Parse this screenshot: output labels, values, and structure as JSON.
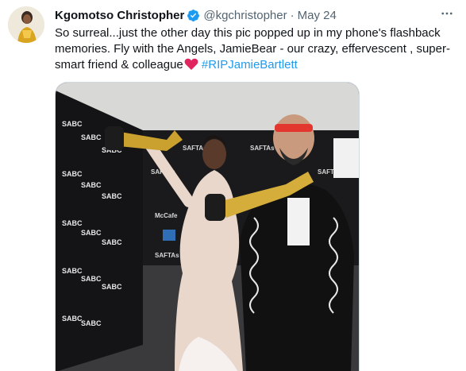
{
  "tweet": {
    "author_name": "Kgomotso Christopher",
    "handle": "@kgchristopher",
    "separator": "·",
    "date": "May 24",
    "text_lines": [
      "So surreal...just the other day this pic popped up in my phone's flashback",
      "memories. Fly with the Angels, JamieBear - our crazy, effervescent , super-"
    ],
    "text_line3": "smart friend & colleague",
    "hashtag": "#RIPJamieBartlett",
    "verified": true,
    "accent_color": "#1d9bf0",
    "heart_color": "#e0245e"
  },
  "icons": {
    "verified": "verified-badge-icon",
    "more": "more-options-icon",
    "heart": "red-heart-emoji-icon"
  },
  "media": {
    "description_kind": "photo",
    "backdrop_logo": "SAFTAs",
    "sponsor_logo": "SABC"
  }
}
